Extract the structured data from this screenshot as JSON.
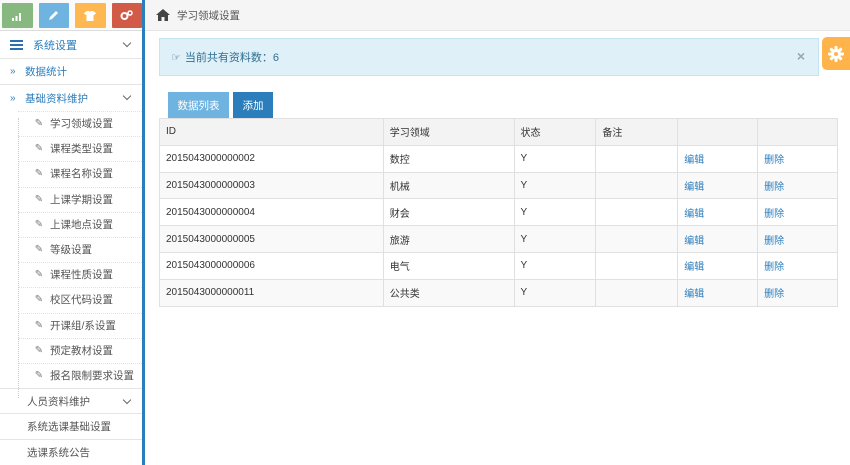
{
  "shortcuts": [
    {
      "name": "stats",
      "color": "#87b87f",
      "icon": "bar-chart-icon"
    },
    {
      "name": "edit",
      "color": "#6fb3e0",
      "icon": "pencil-icon"
    },
    {
      "name": "users",
      "color": "#ffb752",
      "icon": "shirt-icon"
    },
    {
      "name": "settings",
      "color": "#d15b47",
      "icon": "cogs-icon"
    }
  ],
  "sidebar": {
    "header": "系统设置",
    "items": [
      {
        "label": "数据统计"
      },
      {
        "label": "基础资料维护"
      }
    ],
    "sub_items": [
      {
        "label": "学习领域设置"
      },
      {
        "label": "课程类型设置"
      },
      {
        "label": "课程名称设置"
      },
      {
        "label": "上课学期设置"
      },
      {
        "label": "上课地点设置"
      },
      {
        "label": "等级设置"
      },
      {
        "label": "课程性质设置"
      },
      {
        "label": "校区代码设置"
      },
      {
        "label": "开课组/系设置"
      },
      {
        "label": "预定教材设置"
      },
      {
        "label": "报名限制要求设置"
      }
    ],
    "bottom_items": [
      {
        "label": "人员资料维护"
      },
      {
        "label": "系统选课基础设置"
      },
      {
        "label": "选课系统公告"
      }
    ]
  },
  "breadcrumb": {
    "title": "学习领域设置"
  },
  "alert": {
    "text": "当前共有资料数：6"
  },
  "buttons": {
    "list_label": "数据列表",
    "add_label": "添加"
  },
  "table": {
    "headers": [
      "ID",
      "学习领域",
      "状态",
      "备注",
      "",
      ""
    ],
    "rows": [
      {
        "id": "2015043000000002",
        "field": "数控",
        "status": "Y",
        "note": "",
        "edit": "编辑",
        "del": "删除"
      },
      {
        "id": "2015043000000003",
        "field": "机械",
        "status": "Y",
        "note": "",
        "edit": "编辑",
        "del": "删除"
      },
      {
        "id": "2015043000000004",
        "field": "财会",
        "status": "Y",
        "note": "",
        "edit": "编辑",
        "del": "删除"
      },
      {
        "id": "2015043000000005",
        "field": "旅游",
        "status": "Y",
        "note": "",
        "edit": "编辑",
        "del": "删除"
      },
      {
        "id": "2015043000000006",
        "field": "电气",
        "status": "Y",
        "note": "",
        "edit": "编辑",
        "del": "删除"
      },
      {
        "id": "2015043000000011",
        "field": "公共类",
        "status": "Y",
        "note": "",
        "edit": "编辑",
        "del": "删除"
      }
    ]
  },
  "colors": {
    "primary": "#2b7dbc",
    "info_bg": "#dff0f8",
    "info_text": "#31708f",
    "accent": "#ffb44b"
  }
}
